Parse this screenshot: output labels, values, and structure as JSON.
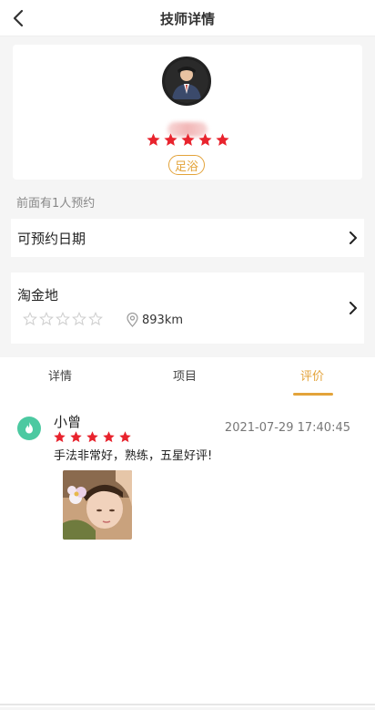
{
  "header": {
    "title": "技师详情",
    "back_icon": "chevron-left-icon"
  },
  "technician": {
    "rating_stars": 5,
    "service_tag": "足浴"
  },
  "queue_text": "前面有1人预约",
  "booking": {
    "label": "可预约日期"
  },
  "shop": {
    "name": "淘金地",
    "distance": "893km",
    "rating_stars": 0
  },
  "tabs": [
    {
      "label": "详情",
      "active": false
    },
    {
      "label": "项目",
      "active": false
    },
    {
      "label": "评价",
      "active": true
    }
  ],
  "reviews": [
    {
      "user": "小曾",
      "stars": 5,
      "time": "2021-07-29 17:40:45",
      "text": "手法非常好，熟练，五星好评!"
    }
  ],
  "colors": {
    "accent": "#e3a33a",
    "star_red": "#e8232d",
    "star_grey": "#cfcfcf",
    "review_avatar": "#4cc9a1"
  }
}
